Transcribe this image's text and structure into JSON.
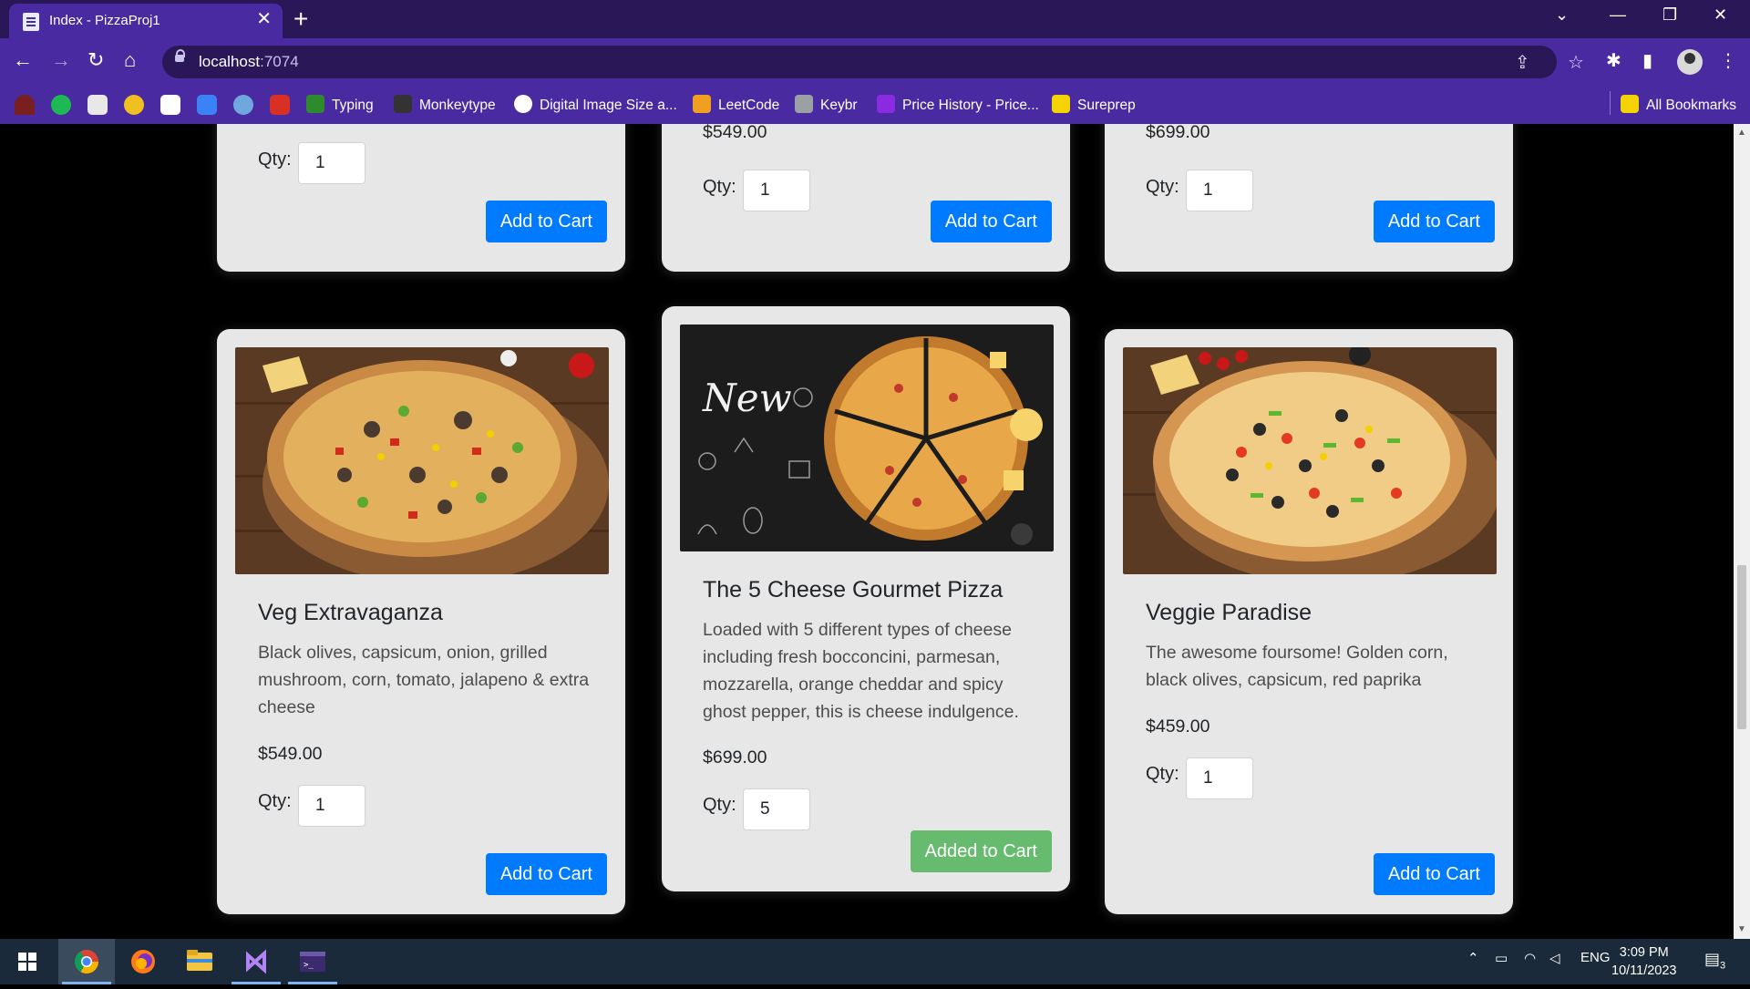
{
  "browser": {
    "tab_title": "Index - PizzaProj1",
    "url_host": "localhost",
    "url_port": ":7074",
    "bookmarks": [
      {
        "label": "Typing",
        "color": "#2d8a2d"
      },
      {
        "label": "Monkeytype",
        "color": "#333333"
      },
      {
        "label": "Digital Image Size a...",
        "color": "#ffffff"
      },
      {
        "label": "LeetCode",
        "color": "#f0a020"
      },
      {
        "label": "Keybr",
        "color": "#9aa0a6"
      },
      {
        "label": "Price History - Price...",
        "color": "#8a2be2"
      },
      {
        "label": "Sureprep",
        "color": "#f5d300"
      }
    ],
    "all_bookmarks": "All Bookmarks"
  },
  "products_top": [
    {
      "price": "",
      "qty_label": "Qty:",
      "qty": "1",
      "button": "Add to Cart"
    },
    {
      "price": "$549.00",
      "qty_label": "Qty:",
      "qty": "1",
      "button": "Add to Cart"
    },
    {
      "price": "$699.00",
      "qty_label": "Qty:",
      "qty": "1",
      "button": "Add to Cart"
    }
  ],
  "products": [
    {
      "name": "Veg Extravaganza",
      "description": "Black olives, capsicum, onion, grilled mushroom, corn, tomato, jalapeno & extra cheese",
      "price": "$549.00",
      "qty_label": "Qty:",
      "qty": "1",
      "button": "Add to Cart"
    },
    {
      "name": "The 5 Cheese Gourmet Pizza",
      "description": "Loaded with 5 different types of cheese including fresh bocconcini, parmesan, mozzarella, orange cheddar and spicy ghost pepper, this is cheese indulgence.",
      "price": "$699.00",
      "qty_label": "Qty:",
      "qty": "5",
      "button": "Added to Cart",
      "image_text": "New"
    },
    {
      "name": "Veggie Paradise",
      "description": "The awesome foursome! Golden corn, black olives, capsicum, red paprika",
      "price": "$459.00",
      "qty_label": "Qty:",
      "qty": "1",
      "button": "Add to Cart"
    }
  ],
  "taskbar": {
    "language": "ENG",
    "time": "3:09 PM",
    "date": "10/11/2023",
    "notifications": "3"
  }
}
